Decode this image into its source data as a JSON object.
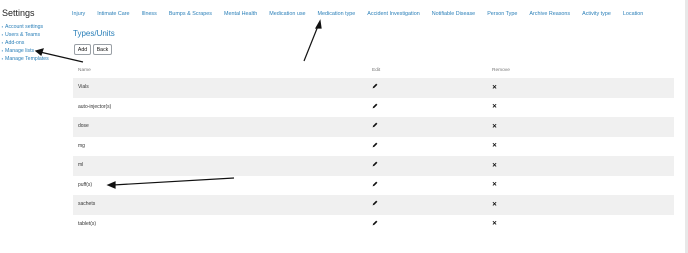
{
  "sidebar": {
    "title": "Settings",
    "items": [
      {
        "label": "Account settings",
        "icon": "gear-icon"
      },
      {
        "label": "Users & Teams",
        "icon": "users-icon"
      },
      {
        "label": "Add-ons",
        "icon": "puzzle-icon"
      },
      {
        "label": "Manage lists",
        "icon": "list-icon"
      },
      {
        "label": "Manage Templates",
        "icon": "template-icon"
      }
    ]
  },
  "tabs": [
    "Injury",
    "Intimate Care",
    "Illness",
    "Bumps & Scrapes",
    "Mental Health",
    "Medication use",
    "Medication type",
    "Accident Investigation",
    "Notifiable Disease",
    "Person Type",
    "Archive Reasons",
    "Activity type",
    "Location"
  ],
  "page": {
    "title": "Types/Units",
    "add_label": "Add",
    "back_label": "Back"
  },
  "table": {
    "headers": {
      "name": "Name",
      "edit": "Edit",
      "remove": "Remove"
    },
    "rows": [
      "Vials",
      "auto-injector(s)",
      "dose",
      "mg",
      "ml",
      "puff(s)",
      "sachets",
      "tablet(s)"
    ],
    "remove_glyph": "✕"
  },
  "colors": {
    "link": "#2a7fb8",
    "row_stripe": "#f0f0f0",
    "annotation": "#111111"
  }
}
